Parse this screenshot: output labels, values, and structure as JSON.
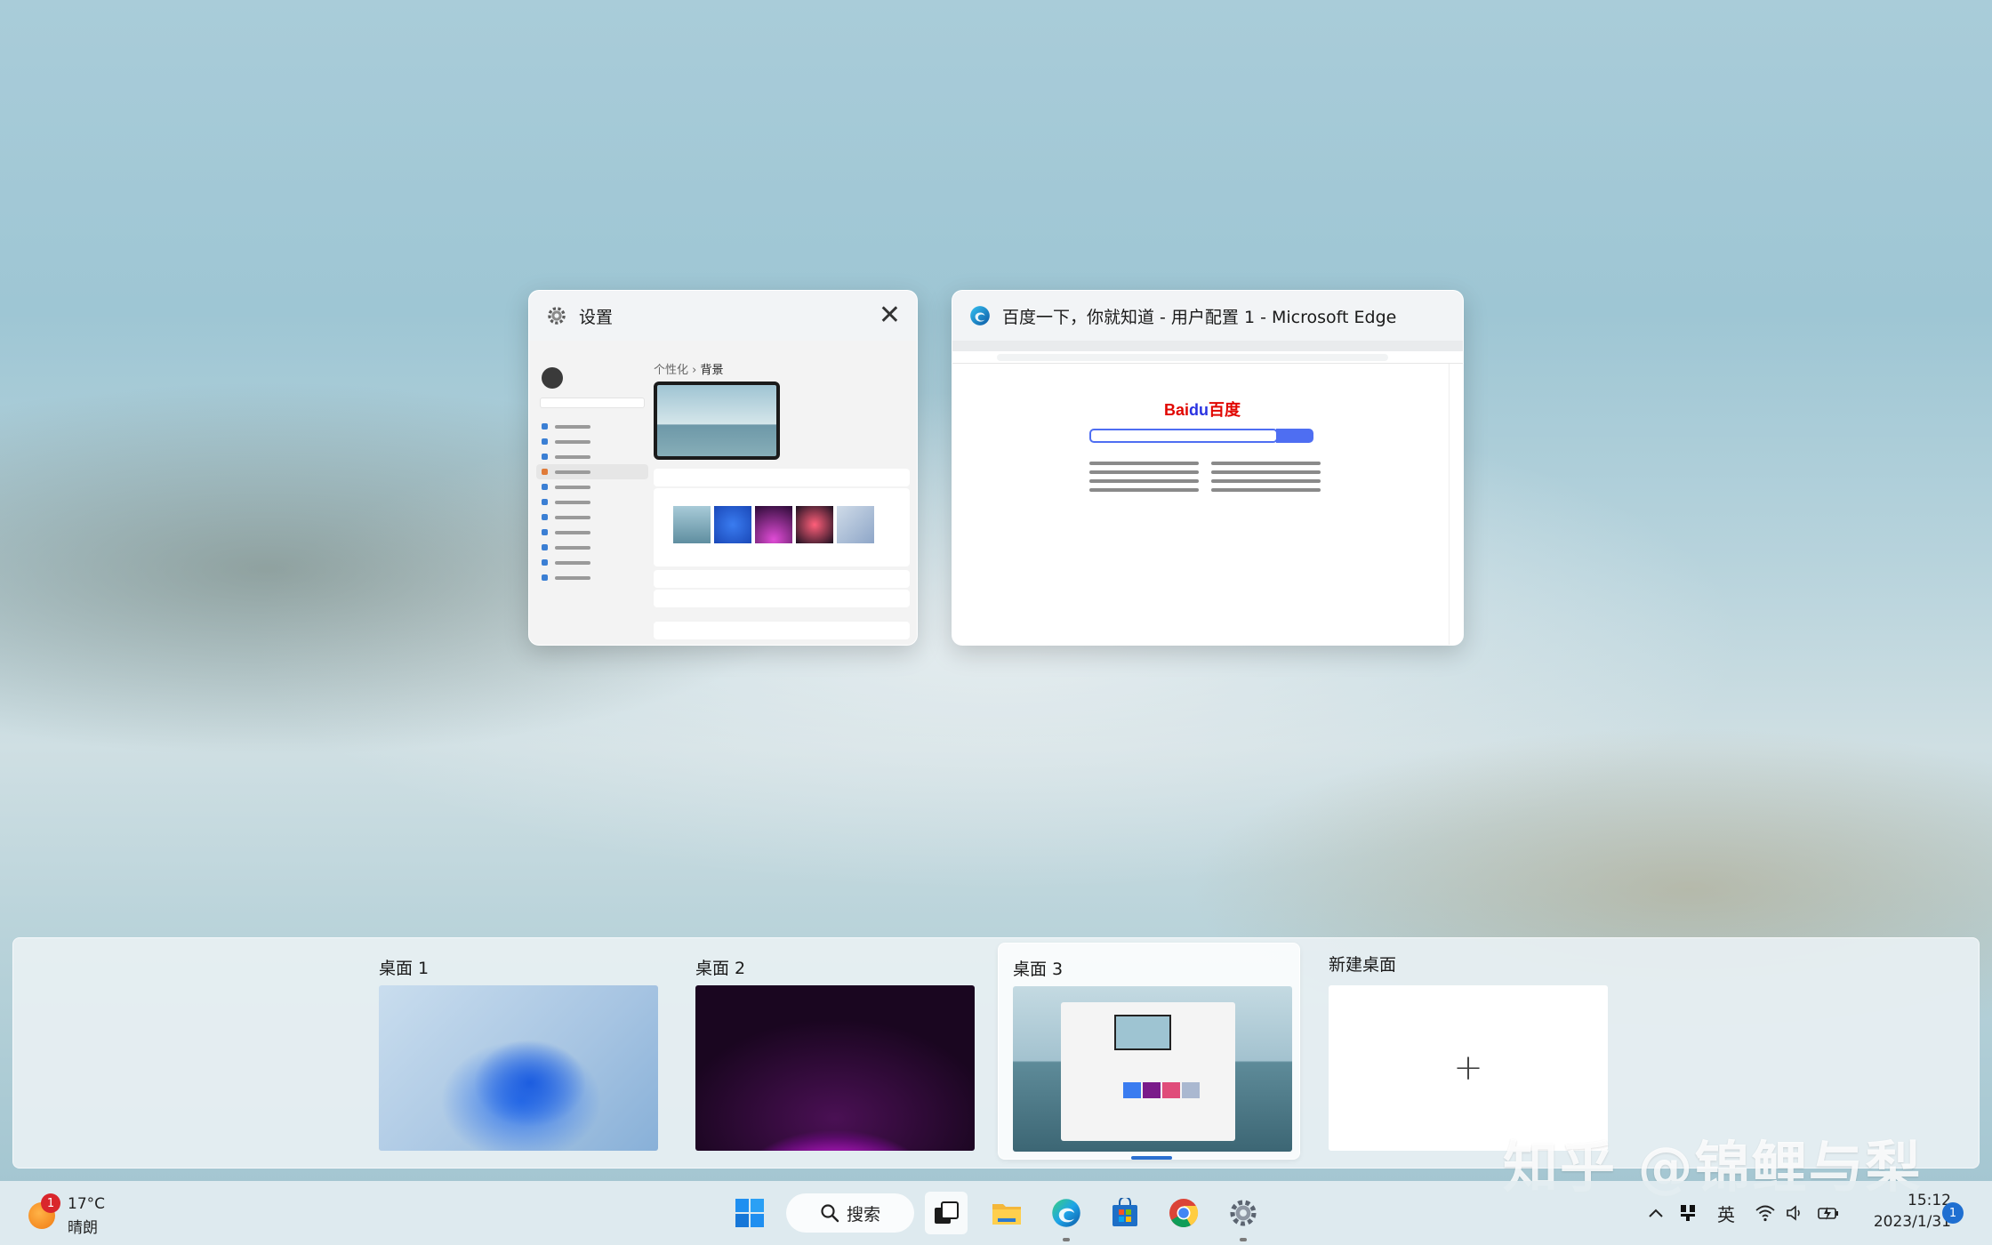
{
  "windows": [
    {
      "app": "settings",
      "title": "设置",
      "crumb_parent": "个性化",
      "crumb_sep": "›",
      "crumb_current": "背景",
      "close_label": "✕"
    },
    {
      "app": "edge",
      "title": "百度一下，你就知道 - 用户配置 1 - Microsoft Edge",
      "page_logo": "Bai",
      "page_logo_du": "du",
      "page_logo_cn": "百度"
    }
  ],
  "desktops": [
    {
      "label": "桌面 1",
      "current": false
    },
    {
      "label": "桌面 2",
      "current": false
    },
    {
      "label": "桌面 3",
      "current": true
    },
    {
      "label": "新建桌面",
      "plus": "+"
    }
  ],
  "watermark": "知乎 @锦鲤与梨",
  "taskbar": {
    "weather": {
      "badge": "1",
      "temp": "17°C",
      "condition": "晴朗"
    },
    "search_label": "搜索",
    "apps": [
      "start-icon",
      "task-view-icon",
      "file-explorer-icon",
      "edge-icon",
      "store-icon",
      "chrome-icon",
      "settings-icon"
    ],
    "tray": {
      "chevron": "^",
      "ime": "英",
      "time": "15:12",
      "date": "2023/1/31",
      "notifications": "1"
    }
  },
  "colors": {
    "accent": "#1f6fd1",
    "baidu_red": "#e10601",
    "baidu_blue": "#4e6ef2"
  }
}
